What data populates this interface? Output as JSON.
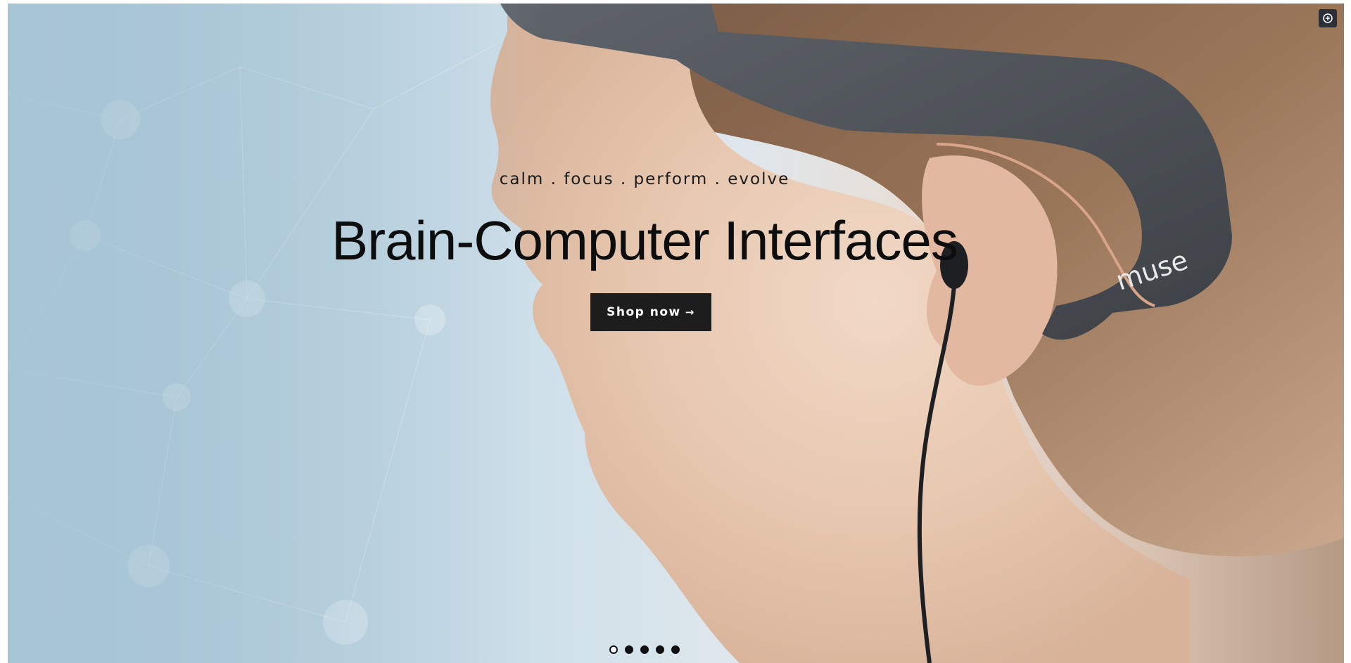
{
  "hero": {
    "tagline": "calm . focus . perform . evolve",
    "headline": "Brain-Computer Interfaces",
    "cta_label": "Shop now",
    "cta_arrow": "→",
    "headband_brand": "muse"
  },
  "slider": {
    "dots": [
      {
        "label": "slide-1",
        "active": true
      },
      {
        "label": "slide-2",
        "active": false
      },
      {
        "label": "slide-3",
        "active": false
      },
      {
        "label": "slide-4",
        "active": false
      },
      {
        "label": "slide-5",
        "active": false
      }
    ]
  },
  "corner": {
    "icon": "plus-circle-icon"
  }
}
